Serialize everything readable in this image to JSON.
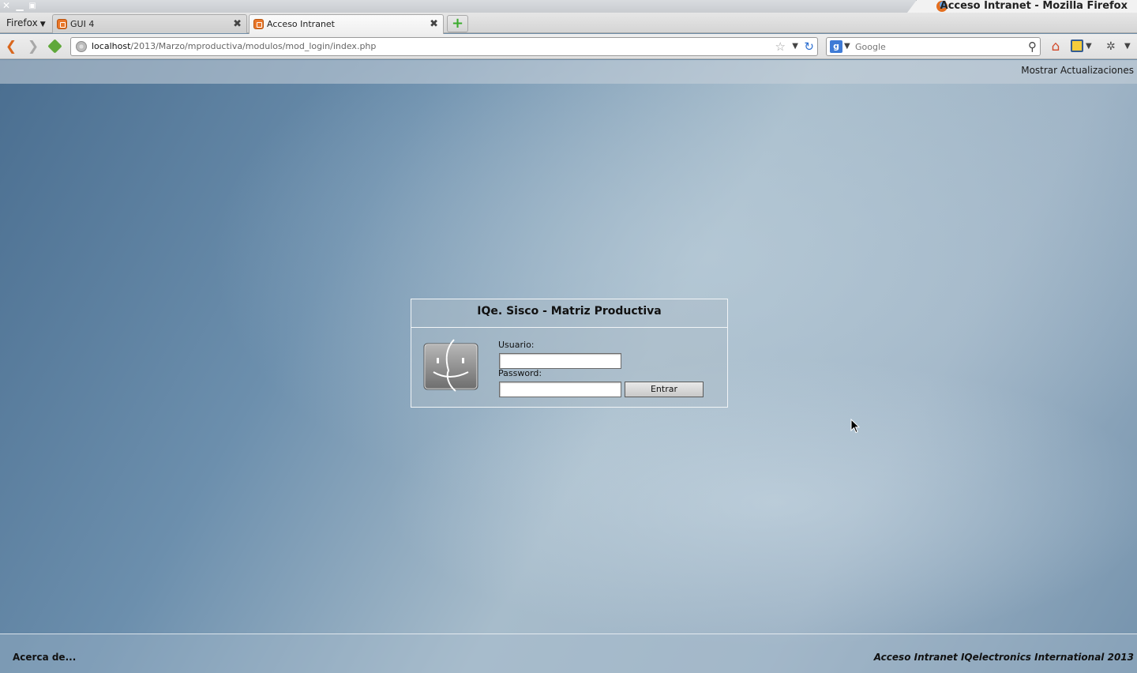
{
  "window": {
    "title": "Acceso Intranet - Mozilla Firefox",
    "controls": {
      "close": "✕",
      "minimize": "▁",
      "maximize": "▣"
    }
  },
  "browser": {
    "menu_label": "Firefox",
    "tabs": [
      {
        "label": "GUI 4",
        "active": false
      },
      {
        "label": "Acceso Intranet",
        "active": true
      }
    ],
    "new_tab_label": "+",
    "url": {
      "host": "localhost",
      "path": "/2013/Marzo/mproductiva/modulos/mod_login/index.php"
    },
    "search_placeholder": "Google"
  },
  "page": {
    "updates_link": "Mostrar Actualizaciones",
    "login": {
      "title": "IQe. Sisco - Matriz Productiva",
      "user_label": "Usuario:",
      "user_value": "",
      "password_label": "Password:",
      "password_value": "",
      "submit_label": "Entrar"
    },
    "footer": {
      "about_link": "Acerca de...",
      "credit": "Acceso Intranet IQelectronics International 2013"
    }
  },
  "icons": {
    "back": "back-arrow-icon",
    "forward": "forward-arrow-icon",
    "addon": "addon-icon",
    "login_logo": "finder-icon"
  },
  "colors": {
    "page_background": "#6f8ea8",
    "back_arrow": "#d9671e",
    "reload": "#2d6fd0",
    "home": "#d2492a",
    "new_tab_plus": "#3bab2d"
  }
}
